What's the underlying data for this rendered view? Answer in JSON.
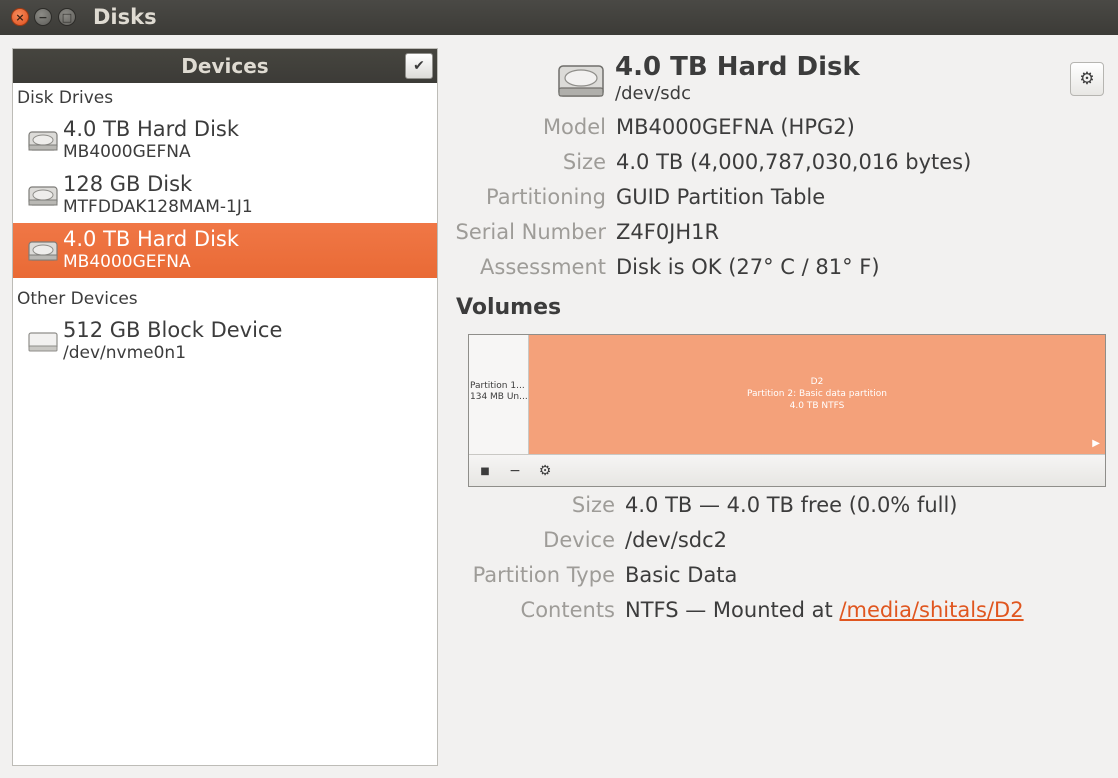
{
  "window": {
    "title": "Disks",
    "close_glyph": "×",
    "min_glyph": "−",
    "max_glyph": "□"
  },
  "sidebar": {
    "title": "Devices",
    "check_glyph": "✔",
    "groups": [
      {
        "label": "Disk Drives",
        "items": [
          {
            "name": "4.0 TB Hard Disk",
            "sub": "MB4000GEFNA",
            "icon": "hard-disk-icon",
            "selected": false
          },
          {
            "name": "128 GB Disk",
            "sub": "MTFDDAK128MAM-1J1",
            "icon": "hard-disk-icon",
            "selected": false
          },
          {
            "name": "4.0 TB Hard Disk",
            "sub": "MB4000GEFNA",
            "icon": "hard-disk-icon",
            "selected": true
          }
        ]
      },
      {
        "label": "Other Devices",
        "items": [
          {
            "name": "512 GB Block Device",
            "sub": "/dev/nvme0n1",
            "icon": "block-device-icon",
            "selected": false
          }
        ]
      }
    ]
  },
  "disk": {
    "title": "4.0 TB Hard Disk",
    "path": "/dev/sdc",
    "gear_glyph": "⚙",
    "properties": [
      {
        "key": "Model",
        "value": "MB4000GEFNA (HPG2)"
      },
      {
        "key": "Size",
        "value": "4.0 TB (4,000,787,030,016 bytes)"
      },
      {
        "key": "Partitioning",
        "value": "GUID Partition Table"
      },
      {
        "key": "Serial Number",
        "value": "Z4F0JH1R"
      },
      {
        "key": "Assessment",
        "value": "Disk is OK (27° C / 81° F)"
      }
    ]
  },
  "volumes": {
    "title": "Volumes",
    "partition1": {
      "line1": "Partition 1...",
      "line2": "134 MB Un..."
    },
    "partition2": {
      "line1": "D2",
      "line2": "Partition 2: Basic data partition",
      "line3": "4.0 TB NTFS",
      "arrow": "▶"
    },
    "toolbar": {
      "stop_glyph": "■",
      "remove_glyph": "−",
      "settings_glyph": "⚙"
    },
    "properties": {
      "size": {
        "key": "Size",
        "value": "4.0 TB — 4.0 TB free (0.0% full)"
      },
      "device": {
        "key": "Device",
        "value": "/dev/sdc2"
      },
      "partition_type": {
        "key": "Partition Type",
        "value": "Basic Data"
      },
      "contents": {
        "key": "Contents",
        "value_prefix": "NTFS — Mounted at ",
        "link": "/media/shitals/D2"
      }
    }
  },
  "colors": {
    "accent": "#e96a35",
    "partition_fill": "#f4a17a",
    "link": "#e0561f"
  }
}
